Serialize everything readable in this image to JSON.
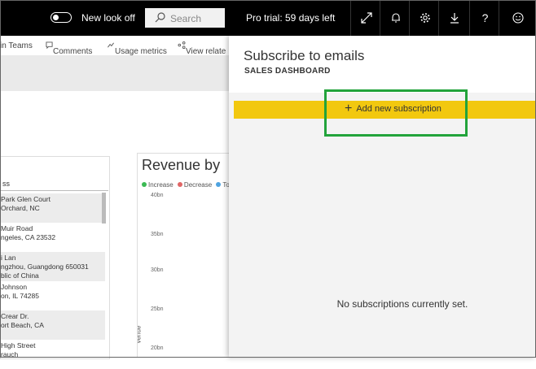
{
  "topbar": {
    "new_look": "New look off",
    "search_placeholder": "Search",
    "pro_trial": "Pro trial: 59 days left",
    "icons": [
      "expand-icon",
      "bell-icon",
      "gear-icon",
      "download-icon",
      "help-icon",
      "smiley-icon"
    ],
    "help_glyph": "?"
  },
  "actionbar": {
    "teams": "in Teams",
    "comments": "Comments",
    "usage": "Usage metrics",
    "view": "View relate"
  },
  "tile1": {
    "header": "ss",
    "rows": [
      {
        "l1": "Park Glen Court",
        "l2": "Orchard, NC"
      },
      {
        "l1": "Muir Road",
        "l2": "ngeles, CA 23532"
      },
      {
        "l1": "i Lan",
        "l2": "ngzhou, Guangdong 650031",
        "l3": "blic of China"
      },
      {
        "l1": "Johnson",
        "l2": "on, IL 74285"
      },
      {
        "l1": "Crear Dr.",
        "l2": "ort Beach, CA"
      },
      {
        "l1": "High Street",
        "l2": "rauch"
      }
    ]
  },
  "tile2": {
    "title": "Revenue by",
    "legend_increase": "Increase",
    "legend_decrease": "Decrease",
    "legend_total": "To",
    "ticks": [
      "40bn",
      "35bn",
      "30bn",
      "25bn",
      "20bn"
    ],
    "ylabel": "venue",
    "colors": {
      "increase": "#3cba54",
      "decrease": "#e06666",
      "total": "#4fa3e0"
    }
  },
  "panel": {
    "title": "Subscribe to emails",
    "subtitle": "SALES DASHBOARD",
    "add_label": "Add new subscription",
    "empty_text": "No subscriptions currently set."
  },
  "colors": {
    "accent": "#f2c80f",
    "highlight": "#22a33b"
  }
}
